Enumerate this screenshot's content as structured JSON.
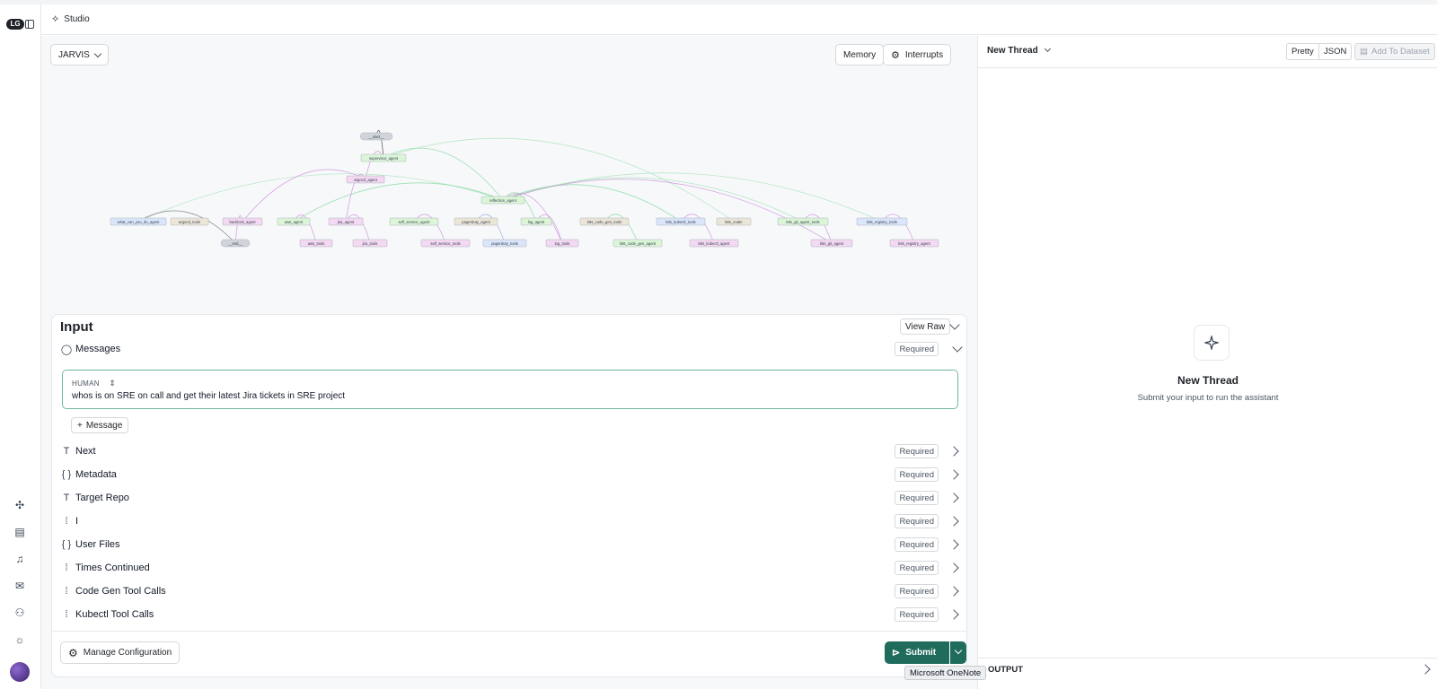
{
  "app": {
    "title": "Studio",
    "logo_text": "LG"
  },
  "rail": {
    "icons": [
      "graph-icon",
      "docs-icon",
      "bell-icon",
      "mail-icon",
      "user-plus-icon",
      "sun-icon"
    ]
  },
  "toolbar": {
    "graph_select": "JARVIS",
    "memory_label": "Memory",
    "interrupts_label": "Interrupts"
  },
  "graph": {
    "nodes": [
      "__start__",
      "supervisor_agent",
      "argocd_agent",
      "reflection_agent",
      "what_can_you_do_agent",
      "argocd_tools",
      "backlock_agent",
      "aws_agent",
      "jira_agent",
      "self_service_agent",
      "pagerduty_agent",
      "log_agent",
      "k8s_code_gen_tools",
      "k8s_kubectl_tools",
      "k8s_coder",
      "k8s_git_agent_tools",
      "k8s_registry_tools",
      "__end__",
      "aws_tools",
      "jira_tools",
      "self_service_tools",
      "pagerduty_tools",
      "log_tools",
      "k8s_code_gen_agent",
      "k8s_kubectl_agent",
      "k8s_git_agent",
      "k8s_registry_agent"
    ]
  },
  "input": {
    "title": "Input",
    "view_raw_label": "View Raw",
    "messages_label": "Messages",
    "required_label": "Required",
    "message": {
      "role": "HUMAN",
      "text": "whos is on SRE on call and get their latest Jira tickets in SRE project"
    },
    "add_message_label": "Message",
    "fields": [
      {
        "label": "Next",
        "icon": "text-icon"
      },
      {
        "label": "Metadata",
        "icon": "braces-icon"
      },
      {
        "label": "Target Repo",
        "icon": "text-icon"
      },
      {
        "label": "I",
        "icon": "number-icon"
      },
      {
        "label": "User Files",
        "icon": "braces-icon"
      },
      {
        "label": "Times Continued",
        "icon": "number-icon"
      },
      {
        "label": "Code Gen Tool Calls",
        "icon": "number-icon"
      },
      {
        "label": "Kubectl Tool Calls",
        "icon": "number-icon"
      }
    ],
    "manage_config_label": "Manage Configuration",
    "submit_label": "Submit"
  },
  "thread": {
    "title": "New Thread",
    "pretty_label": "Pretty",
    "json_label": "JSON",
    "add_dataset_label": "Add To Dataset",
    "empty_title": "New Thread",
    "empty_subtitle": "Submit your input to run the assistant",
    "output_label": "OUTPUT"
  },
  "tooltip": {
    "text": "Microsoft OneNote"
  },
  "colors": {
    "accent": "#1f6b5c",
    "message_border": "#6fb8a4"
  }
}
